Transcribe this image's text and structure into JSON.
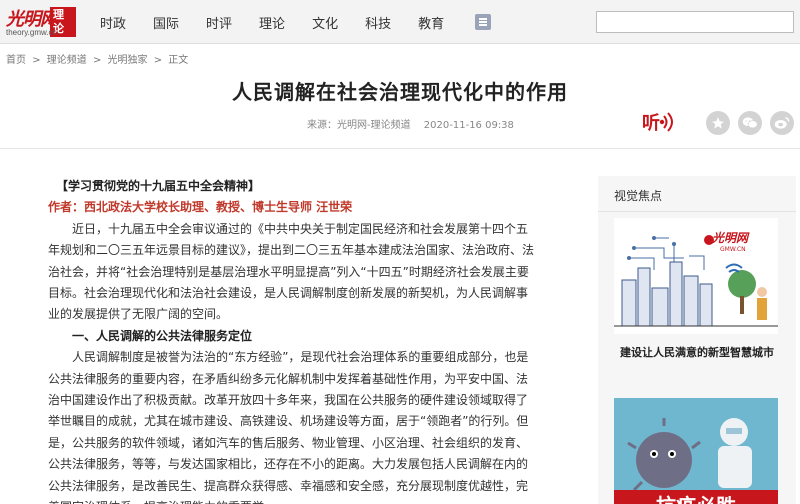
{
  "header": {
    "logo_brand": "光明网",
    "logo_badge": "理论",
    "logo_url": "theory.gmw.cn",
    "nav": [
      "时政",
      "国际",
      "时评",
      "理论",
      "文化",
      "科技",
      "教育"
    ],
    "search_placeholder": ""
  },
  "breadcrumb": [
    "首页",
    ">",
    "理论频道",
    ">",
    "光明独家",
    ">",
    "正文"
  ],
  "article": {
    "title": "人民调解在社会治理现代化中的作用",
    "source": "来源：光明网-理论频道",
    "date": "2020-11-16 09:38",
    "heading": "【学习贯彻党的十九届五中全会精神】",
    "author": "作者：西北政法大学校长助理、教授、博士生导师 汪世荣",
    "para1": "近日，十九届五中全会审议通过的《中共中央关于制定国民经济和社会发展第十四个五年规划和二〇三五年远景目标的建议》，提出到二〇三五年基本建成法治国家、法治政府、法治社会，并将“社会治理特别是基层治理水平明显提高”列入“十四五”时期经济社会发展主要目标。社会治理现代化和法治社会建设，是人民调解制度创新发展的新契机，为人民调解事业的发展提供了无限广阔的空间。",
    "section1": "一、人民调解的公共法律服务定位",
    "para2": "人民调解制度是被誉为法治的“东方经验”，是现代社会治理体系的重要组成部分，也是公共法律服务的重要内容，在矛盾纠纷多元化解机制中发挥着基础性作用，为平安中国、法治中国建设作出了积极贡献。改革开放四十多年来，我国在公共服务的硬件建设领域取得了举世瞩目的成就，尤其在城市建设、高铁建设、机场建设等方面，居于“领跑者”的行列。但是，公共服务的软件领域，诸如汽车的售后服务、物业管理、小区治理、社会组织的发育、公共法律服务，等等，与发达国家相比，还存在不小的距离。大力发展包括人民调解在内的公共法律服务，是改善民生、提高群众获得感、幸福感和安全感，充分展现制度优越性，完善国家治理体系、提高治理能力的重要举"
  },
  "sidebar": {
    "title": "视觉焦点",
    "item1_caption": "建设让人民满意的新型智慧城市",
    "item1_logo": "光明网",
    "item1_logo_sub": "GMW.CN",
    "item2_banner": "抗疫必胜"
  },
  "share": {
    "listen_label": "听",
    "icons": [
      "star-icon",
      "wechat-icon",
      "weibo-icon"
    ]
  },
  "colors": {
    "brand_red": "#c8161d",
    "author_red": "#c0392b"
  }
}
